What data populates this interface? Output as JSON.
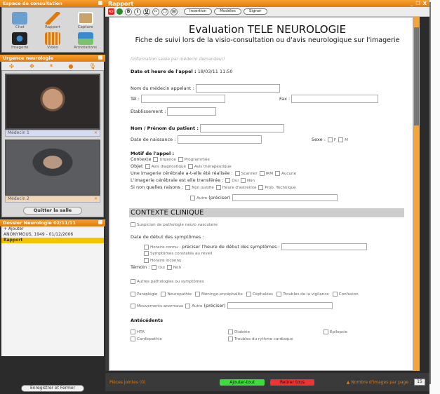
{
  "left": {
    "panel_title": "Espace de consultation",
    "tools": [
      {
        "label": "Chat",
        "icon": "chat-icon",
        "color": "#6a9fd0"
      },
      {
        "label": "Rapport",
        "icon": "pen-icon",
        "color": "#e07a0a"
      },
      {
        "label": "Capture",
        "icon": "capture-icon",
        "color": "#c9a36b"
      },
      {
        "label": "Imagerie",
        "icon": "imaging-icon",
        "color": "#222"
      },
      {
        "label": "Video",
        "icon": "video-icon",
        "color": "#e07a0a"
      },
      {
        "label": "Annotations",
        "icon": "annotation-icon",
        "color": "#3a8ad0"
      }
    ],
    "urgence_title": "Urgence neurologie",
    "controls": [
      "✣",
      "✥",
      "⏸",
      "●",
      "🎙"
    ],
    "video1_label": "Médecin 1",
    "video2_label": "Médecin 2",
    "quit_label": "Quitter la salle",
    "dossier_title": "Dossier Neurologie 02/11/11",
    "dossier_rows": [
      "+ Ajouter",
      "ANONYMOUS, 1949 - 01/12/2006",
      "Rapport"
    ],
    "save_label": "Enregistrer et Fermer"
  },
  "window": {
    "title": "Rapport",
    "buttons": [
      "_",
      "❐",
      "X"
    ]
  },
  "toolbar": {
    "pdf": "PDF",
    "fmt": [
      "B",
      "I",
      "U"
    ],
    "insertion": "Insertion",
    "modeles": "Modèles",
    "signer": "Signer"
  },
  "doc": {
    "title": "Evaluation TELE NEUROLOGIE",
    "subtitle": "Fiche de suivi lors de la visio-consultation ou d'avis neurologique sur l'imagerie",
    "info_note": "(Information saisie par médecin demandeur)",
    "date_label": "Date et heure de l'appel :",
    "date_value": "18/03/11 11:50",
    "medecin_label": "Nom du médecin appelant :",
    "tel_label": "Tél :",
    "fax_label": "Fax :",
    "etab_label": "Établissement :",
    "patient_label": "Nom / Prénom du patient :",
    "naissance_label": "Date de naissance :",
    "sexe_label": "Sexe :",
    "sexe_f": "F",
    "sexe_m": "M",
    "motif_label": "Motif de l'appel :",
    "contexte_label": "Contexte",
    "contexte_opts": [
      "Urgence",
      "Programmée"
    ],
    "objet_label": "Objet",
    "objet_opts": [
      "Avis diagnostique",
      "Avis thérapeutique"
    ],
    "imagerie_label": "Une imagerie cérébrale a-t-elle été réalisée :",
    "imagerie_opts": [
      "Scanner",
      "IRM",
      "Aucune"
    ],
    "transferee_label": "L'imagerie cérébrale est elle transférée :",
    "transferee_opts": [
      "Oui",
      "Non"
    ],
    "raisons_label": "Si non quelles raisons :",
    "raisons_opts": [
      "Non justifié",
      "Heure d'astreinte",
      "Prob. Technique"
    ],
    "autre_label": "Autre",
    "preciser": "(préciser)",
    "contexte_clinique": "CONTEXTE CLINIQUE",
    "suspicion": "Suspicion de pathologie neuro vasculaire",
    "debut_label": "Date de début des symptômes :",
    "heure_connu": "Horaire connu :",
    "heure_connu_q": "préciser l'heure de début des symptômes :",
    "symptomes_eveil": "Symptômes constatés au réveil",
    "heure_inconnu": "Horaire inconnu",
    "temoin_label": "Témoin :",
    "temoin_opts": [
      "Oui",
      "Non"
    ],
    "autres_path": "Autres pathologies ou symptômes",
    "symptoms": [
      "Paraplégie",
      "Neuropathie",
      "Méningo-encéphalite",
      "Céphalées",
      "Troubles de la vigilance",
      "Confusion"
    ],
    "mouvements": "Mouvements anormaux",
    "antecedents_label": "Antécédents",
    "antecedents": [
      "HTA",
      "Diabète",
      "Épilepsie",
      "Cardiopathie",
      "Troubles du rythme cardiaque"
    ]
  },
  "footer": {
    "pieces": "Pièces jointes (0)",
    "ajouter": "Ajouter-tout",
    "retirer": "Retirer tous",
    "nb_images": "▲ Nombre d'images par page :",
    "nb_value": "15"
  }
}
